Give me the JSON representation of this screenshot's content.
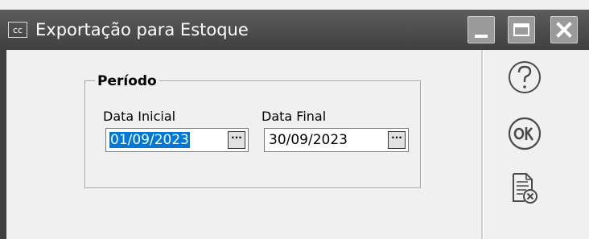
{
  "window": {
    "app_icon_text": "cc",
    "title": "Exportação para Estoque",
    "buttons": [
      "minimize-icon",
      "maximize-icon",
      "close-icon"
    ]
  },
  "periodo": {
    "legend": "Período",
    "data_inicial": {
      "label": "Data Inicial",
      "value": "01/09/2023",
      "button": "···"
    },
    "data_final": {
      "label": "Data Final",
      "value": "30/09/2023",
      "button": "···"
    }
  },
  "side_actions": [
    "help-icon",
    "ok-icon",
    "cancel-document-icon"
  ],
  "colors": {
    "titlebar": "#4a4a4a",
    "selection": "#0078d7",
    "background": "#f0f0f0"
  }
}
